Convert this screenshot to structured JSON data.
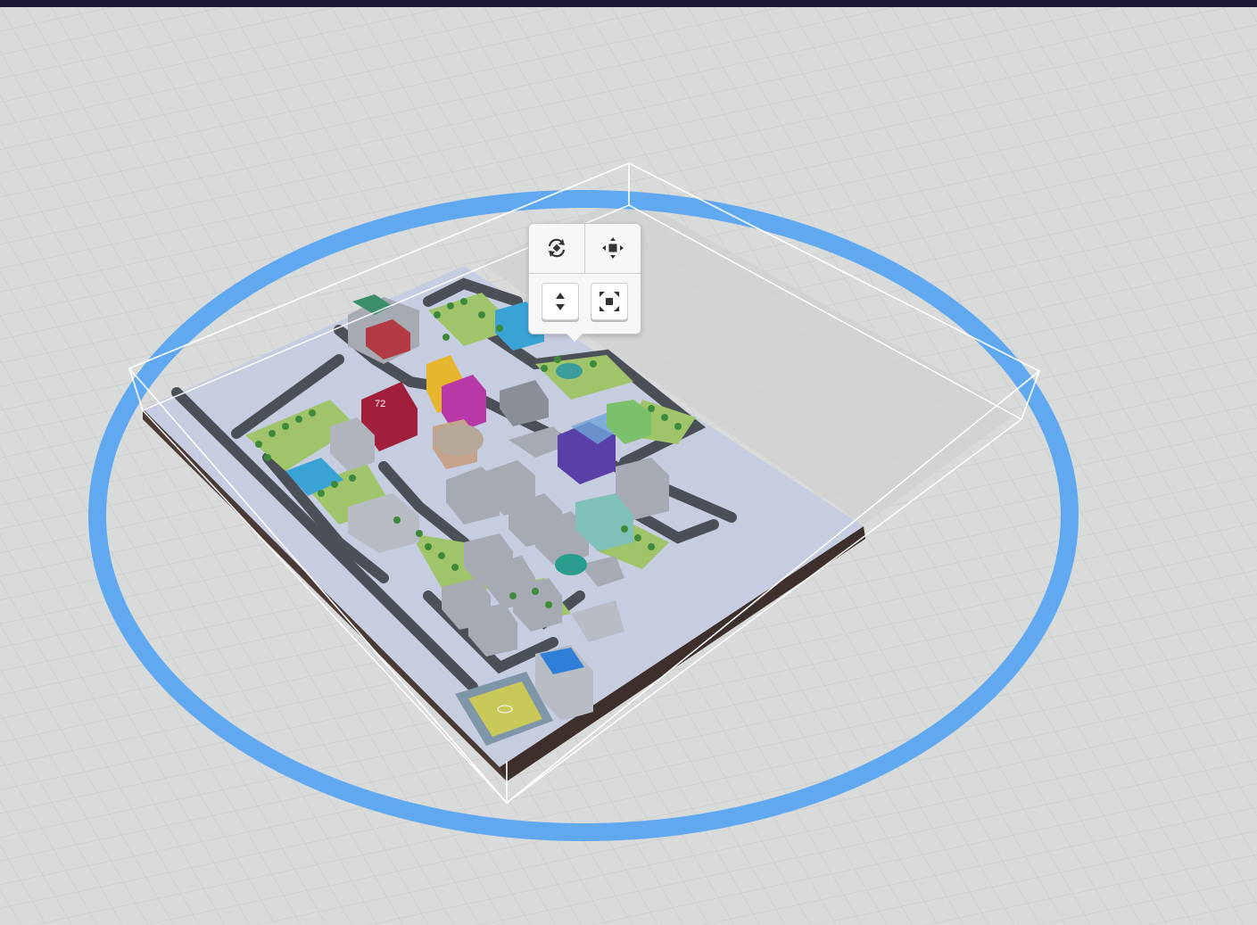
{
  "colors": {
    "topbar": "#1f1633",
    "floor": "#d9dbda",
    "grid_line": "#c4c6c5",
    "ring": "#5aa6f2",
    "bounding_box": "#ffffff",
    "base_plate": "#c7cde0",
    "road": "#4b4f57",
    "grass": "#9fc46a",
    "building": "#a6aab3"
  },
  "toolbar": {
    "buttons": [
      {
        "icon": "rotate-icon"
      },
      {
        "icon": "move-icon"
      },
      {
        "icon": "vertical-move-icon",
        "active": true
      },
      {
        "icon": "scale-icon",
        "active": true
      }
    ]
  },
  "model": {
    "labels": [
      "72"
    ]
  }
}
